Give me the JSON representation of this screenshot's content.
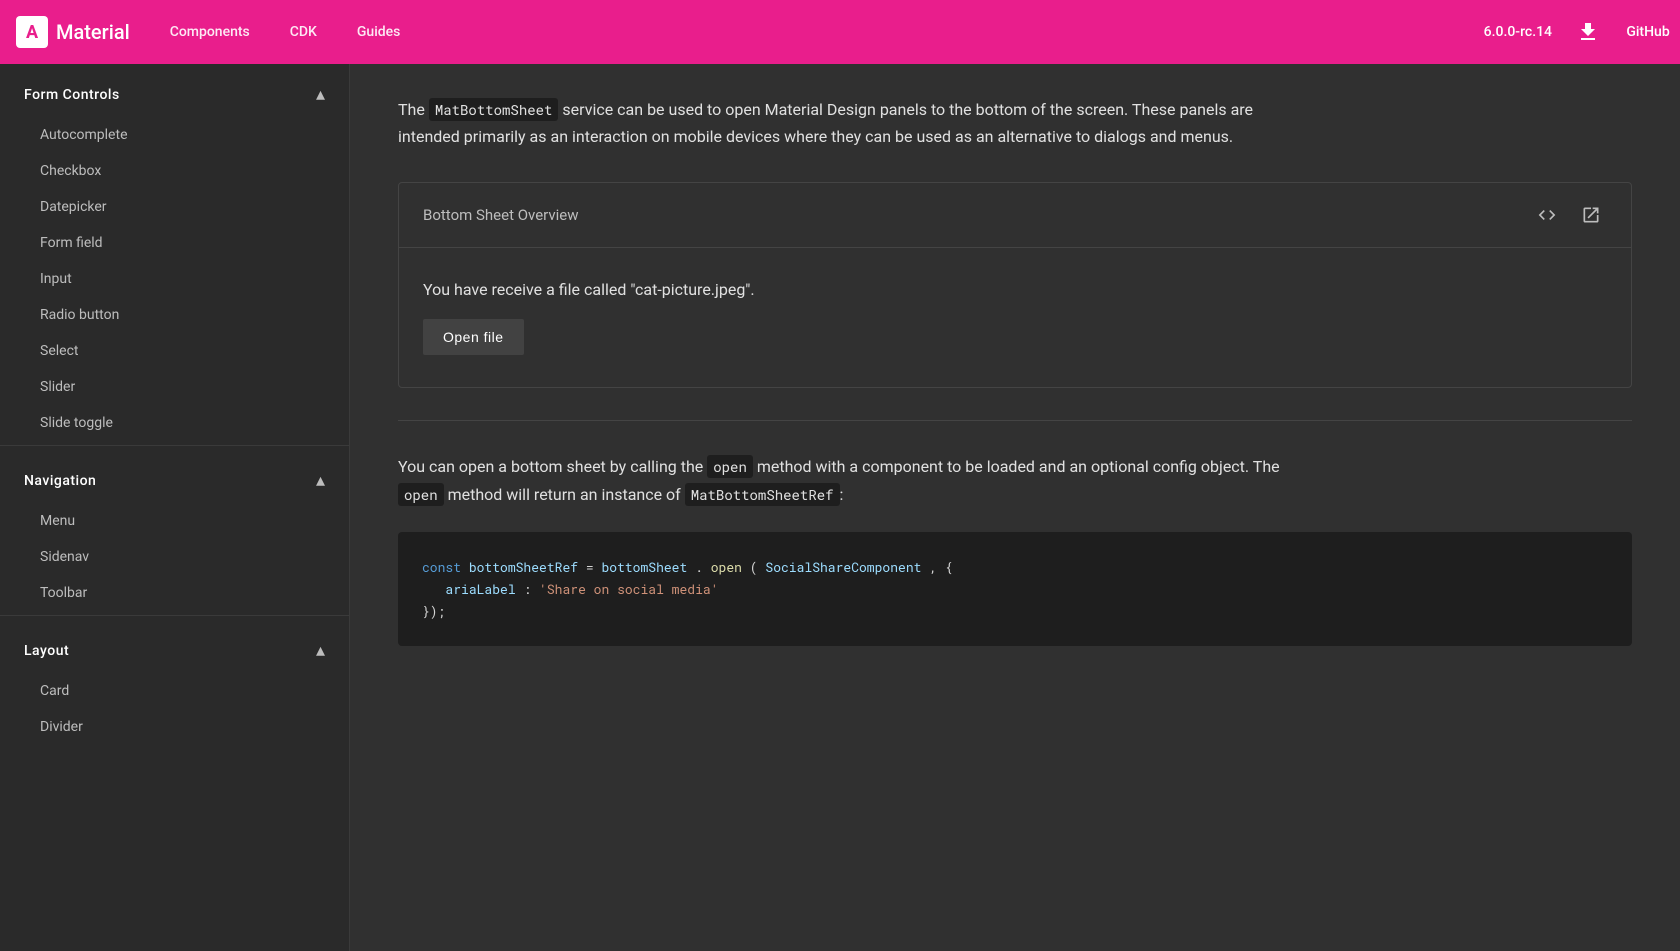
{
  "topNav": {
    "logo": {
      "icon": "A",
      "text": "Material"
    },
    "links": [
      "Components",
      "CDK",
      "Guides"
    ],
    "version": "6.0.0-rc.14",
    "github": "GitHub"
  },
  "sidebar": {
    "sections": [
      {
        "title": "Form Controls",
        "expanded": true,
        "items": [
          "Autocomplete",
          "Checkbox",
          "Datepicker",
          "Form field",
          "Input",
          "Radio button",
          "Select",
          "Slider",
          "Slide toggle"
        ]
      },
      {
        "title": "Navigation",
        "expanded": true,
        "items": [
          "Menu",
          "Sidenav",
          "Toolbar"
        ]
      },
      {
        "title": "Layout",
        "expanded": true,
        "items": [
          "Card",
          "Divider"
        ]
      }
    ]
  },
  "main": {
    "intro": {
      "text1": "The ",
      "code1": "MatBottomSheet",
      "text2": " service can be used to open Material Design panels to the bottom of the screen. These panels are intended primarily as an interaction on mobile devices where they can be used as an alternative to dialogs and menus."
    },
    "demo": {
      "title": "Bottom Sheet Overview",
      "message": "You have receive a file called \"cat-picture.jpeg\".",
      "button_label": "Open file"
    },
    "body_text1": "You can open a bottom sheet by calling the ",
    "code_open": "open",
    "body_text2": " method with a component to be loaded and an optional config object. The ",
    "code_open2": "open",
    "body_text3": " method will return an instance of ",
    "code_ref": "MatBottomSheetRef",
    "body_text4": ":",
    "code_block": {
      "line1_kw": "const",
      "line1_var": "bottomSheetRef",
      "line1_op": " = ",
      "line1_obj": "bottomSheet",
      "line1_fn": "open",
      "line1_arg": "SocialShareComponent",
      "line1_rest": ", {",
      "line2_key": "  ariaLabel",
      "line2_val": "'Share on social media'",
      "line3": "});"
    }
  }
}
